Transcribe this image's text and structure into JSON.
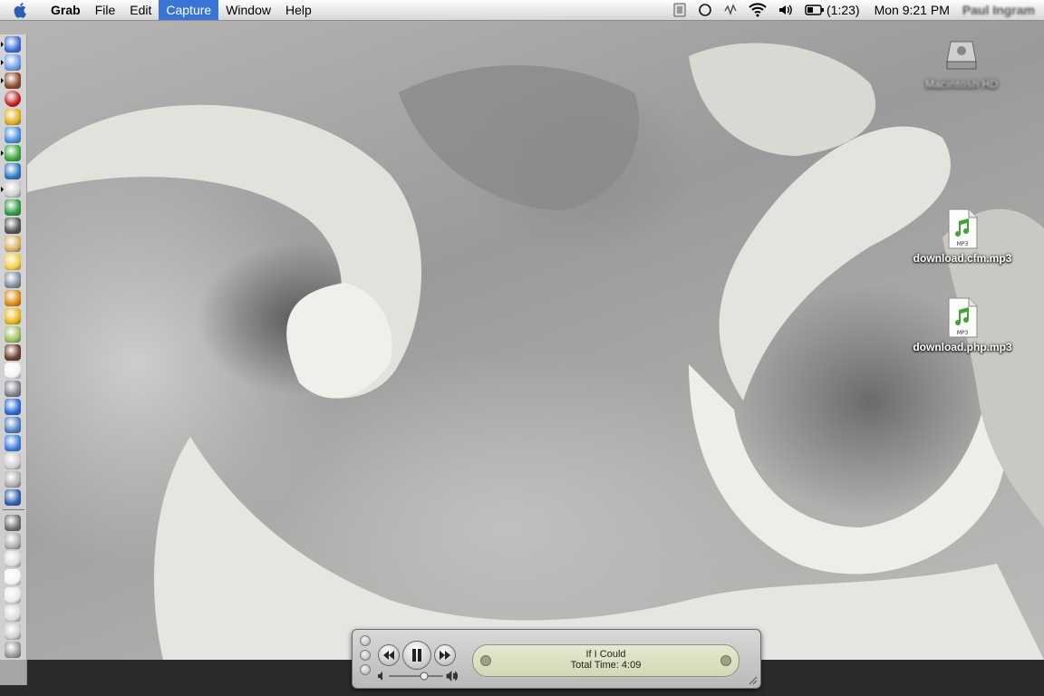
{
  "menubar": {
    "app_name": "Grab",
    "menus": [
      "File",
      "Edit",
      "Capture",
      "Window",
      "Help"
    ],
    "active_menu": "Capture",
    "battery_time": "(1:23)",
    "clock": "Mon 9:21 PM",
    "user_name": "Paul Ingram"
  },
  "desktop": {
    "icons": [
      {
        "label": "Macintosh HD",
        "kind": "drive-icon"
      },
      {
        "label": "download.cfm.mp3",
        "kind": "mp3-file-icon"
      },
      {
        "label": "download.php.mp3",
        "kind": "mp3-file-icon"
      }
    ]
  },
  "dock": {
    "items": [
      "finder-icon",
      "safari-icon",
      "itunes-library-icon",
      "record-icon",
      "magnifier-icon",
      "globe-icon",
      "plant-icon",
      "network-icon",
      "mail-icon",
      "itunes-icon",
      "preview-icon",
      "notes-icon",
      "chat-icon",
      "gears-icon",
      "warning-icon",
      "sunflower-icon",
      "pencil-icon",
      "photo-icon",
      "calendar-icon",
      "sync-icon",
      "quicktime-icon",
      "image-icon",
      "ical-icon",
      "iphoto-icon",
      "app-icon",
      "printer-icon",
      "book-icon",
      "settings-icon",
      "utility-icon",
      "document-icon",
      "document-icon-2",
      "document-icon-3",
      "document-icon-4",
      "trash-icon"
    ]
  },
  "player": {
    "track_title": "If I Could",
    "track_time": "Total Time: 4:09",
    "volume": 0.65,
    "state": "playing"
  },
  "colors": {
    "menu_highlight": "#3875d7",
    "lcd": "#dde0c2"
  }
}
